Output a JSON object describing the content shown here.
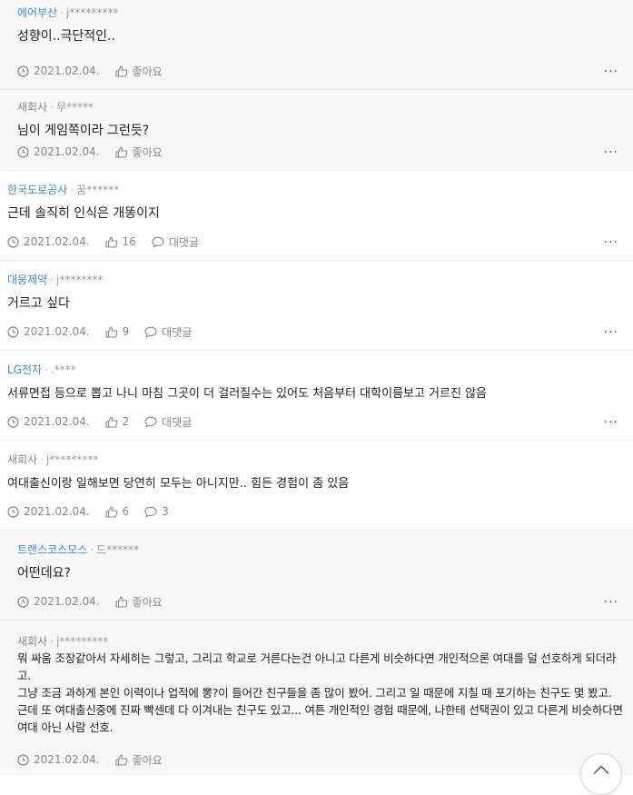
{
  "comments": [
    {
      "company": "에어부산",
      "company_color": "blue",
      "user": "j*********",
      "text": "성향이..극단적인..",
      "date": "2021.02.04.",
      "like_label": "좋아요",
      "reply_label": "",
      "type": "reply"
    },
    {
      "company": "새회사",
      "company_color": "grey",
      "user": "무*****",
      "text": "님이 게임쪽이라 그런듯?",
      "date": "2021.02.04.",
      "like_label": "좋아요",
      "reply_label": "",
      "type": "reply"
    },
    {
      "company": "한국도로공사",
      "company_color": "blue",
      "user": "꿈******",
      "text": "근데 솔직히 인식은 개똥이지",
      "date": "2021.02.04.",
      "like_label": "16",
      "reply_label": "대댓글",
      "type": "root"
    },
    {
      "company": "대웅제약",
      "company_color": "blue",
      "user": "j********",
      "text": "거르고 싶다",
      "date": "2021.02.04.",
      "like_label": "9",
      "reply_label": "대댓글",
      "type": "root"
    },
    {
      "company": "LG전자",
      "company_color": "blue",
      "user": ".****",
      "text": "서류면접 등으로 뽑고 나니 마침 그곳이 더 걸러질수는 있어도 처음부터 대학이름보고 거르진 않음",
      "date": "2021.02.04.",
      "like_label": "2",
      "reply_label": "대댓글",
      "type": "root"
    },
    {
      "company": "새회사",
      "company_color": "grey",
      "user": "j*********",
      "text": "여대출신이랑 일해보면 당연히 모두는 아니지만.. 힘든 경험이 좀 있음",
      "date": "2021.02.04.",
      "like_label": "6",
      "reply_label": "3",
      "type": "root"
    },
    {
      "company": "트랜스코스모스",
      "company_color": "blue",
      "user": "드******",
      "text": "어떤데요?",
      "date": "2021.02.04.",
      "like_label": "좋아요",
      "reply_label": "",
      "type": "reply"
    },
    {
      "company": "새회사",
      "company_color": "grey",
      "user": "j*********",
      "text": "뭐 싸움 조장같아서 자세히는 그렇고, 그리고 학교로 거른다는건 아니고 다른게 비슷하다면 개인적으론 여대를 덜 선호하게 되더라고.\n그냥 조금 과하게 본인 이력이나 업적에 뽕?이 들어간 친구들을 좀 많이 봤어. 그리고 일 때문에 지칠 때 포기하는 친구도 몇 봤고. 근데 또 여대출신중에 진짜 빡센데 다 이겨내는 친구도 있고... 여튼 개인적인 경험 때문에, 나한테 선택권이 있고 다른게 비슷하다면 여대 아닌 사람 선호.",
      "date": "2021.02.04.",
      "like_label": "좋아요",
      "reply_label": "",
      "type": "reply"
    }
  ]
}
